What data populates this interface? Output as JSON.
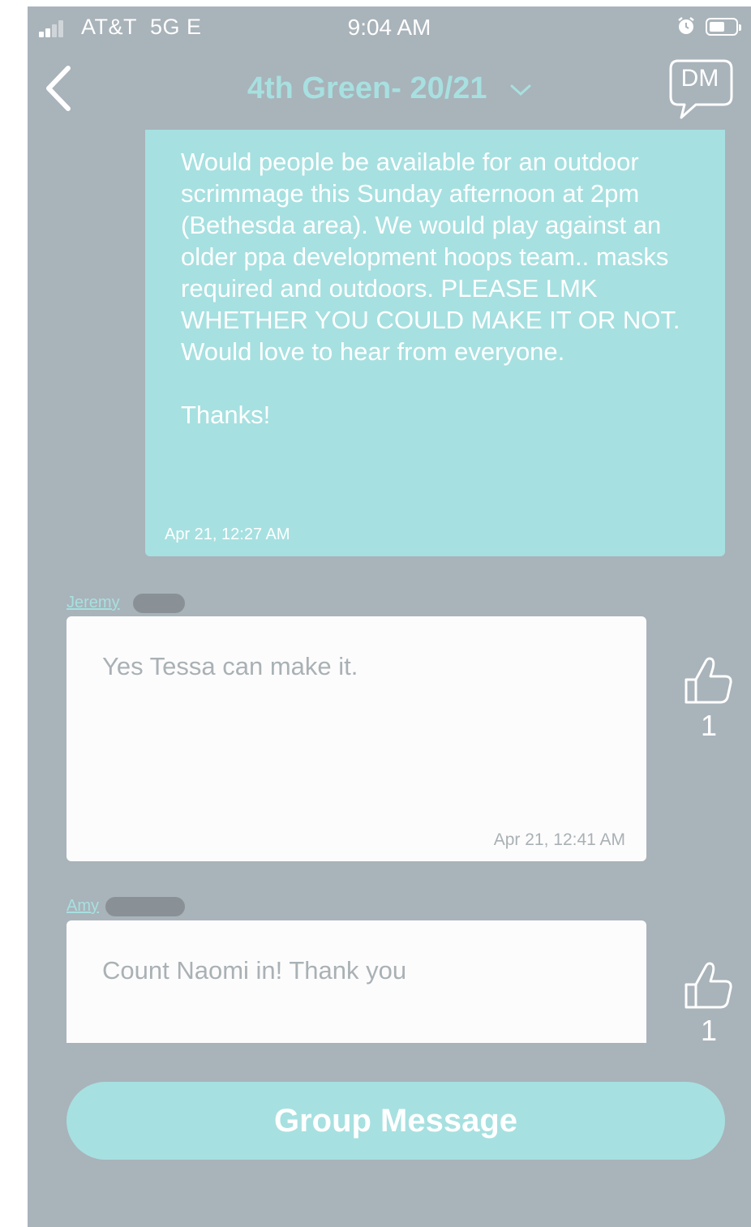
{
  "status_bar": {
    "carrier": "AT&T",
    "network": "5G E",
    "time": "9:04 AM"
  },
  "nav": {
    "title": "4th Green- 20/21",
    "dm_label": "DM"
  },
  "own_message": {
    "text": "Would people be available for an outdoor scrimmage this Sunday afternoon at 2pm (Bethesda area). We would play against an older ppa development hoops team.. masks required and outdoors. PLEASE LMK WHETHER YOU COULD MAKE IT OR NOT. Would love to hear from everyone.\n\nThanks!",
    "timestamp": "Apr 21, 12:27 AM"
  },
  "replies": [
    {
      "sender": "Jeremy",
      "text": "Yes Tessa can make it.",
      "timestamp": "Apr 21, 12:41 AM",
      "likes": "1"
    },
    {
      "sender": "Amy",
      "text": "Count Naomi in! Thank you",
      "likes": "1"
    }
  ],
  "group_message_label": "Group Message",
  "colors": {
    "accent": "#a7e0e0",
    "background": "#a9b3ba",
    "bubble": "#fdfcfc"
  }
}
